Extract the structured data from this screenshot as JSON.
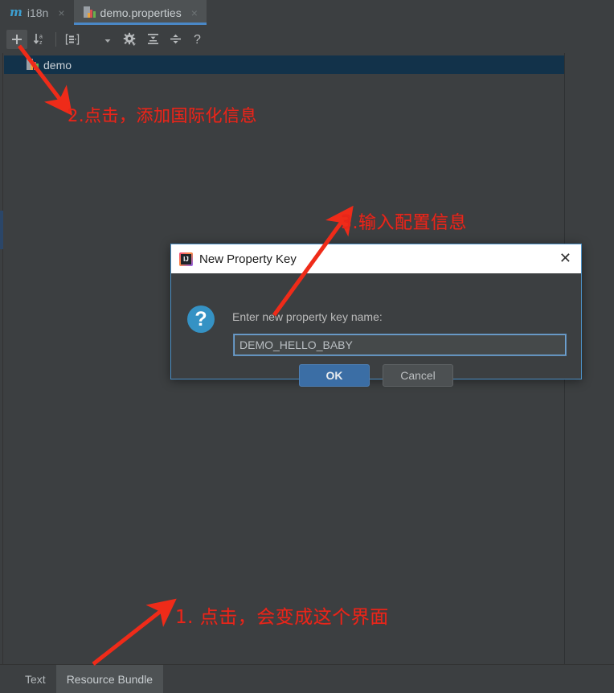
{
  "window": {
    "background": "#3c3f41",
    "accent": "#4a88c7",
    "annotation_color": "#e8261b"
  },
  "editor_tabs": [
    {
      "label": "i18n",
      "icon": "maven-module-icon",
      "close": "×",
      "active": false
    },
    {
      "label": "demo.properties",
      "icon": "resource-bundle-icon",
      "close": "×",
      "active": true
    }
  ],
  "toolbar": {
    "buttons": [
      {
        "name": "add-property-button",
        "icon": "plus-icon",
        "tooltip": "Add Property",
        "pressed": true
      },
      {
        "name": "sort-alphabetically-button",
        "icon": "sort-az-icon",
        "tooltip": "Sort",
        "pressed": false
      },
      {
        "name": "group-by-button",
        "icon": "group-structure-icon",
        "tooltip": "Group",
        "pressed": false
      },
      {
        "name": "settings-button",
        "icon": "gear-dropdown-icon",
        "tooltip": "Settings",
        "pressed": false
      },
      {
        "name": "expand-all-button",
        "icon": "expand-all-icon",
        "tooltip": "Expand All",
        "pressed": false
      },
      {
        "name": "collapse-all-button",
        "icon": "collapse-all-icon",
        "tooltip": "Collapse All",
        "pressed": false
      },
      {
        "name": "help-button",
        "icon": "question-mark-icon",
        "tooltip": "Help",
        "pressed": false
      }
    ]
  },
  "tree": {
    "rows": [
      {
        "label": "demo",
        "icon": "resource-bundle-icon",
        "selected": true
      }
    ]
  },
  "dialog": {
    "title": "New Property Key",
    "title_icon": "intellij-idea-icon",
    "close_label": "✕",
    "body_icon": "question-mark-circle-icon",
    "prompt": "Enter new property key name:",
    "input_value": "DEMO_HELLO_BABY",
    "input_placeholder": "",
    "ok_label": "OK",
    "cancel_label": "Cancel"
  },
  "bottom_tabs": [
    {
      "label": "Text",
      "active": false
    },
    {
      "label": "Resource Bundle",
      "active": true
    }
  ],
  "annotations": [
    {
      "id": "1",
      "text": "1. 点击，会变成这个界面"
    },
    {
      "id": "2",
      "text": "2.点击，添加国际化信息"
    },
    {
      "id": "3",
      "text": "3.输入配置信息"
    }
  ]
}
